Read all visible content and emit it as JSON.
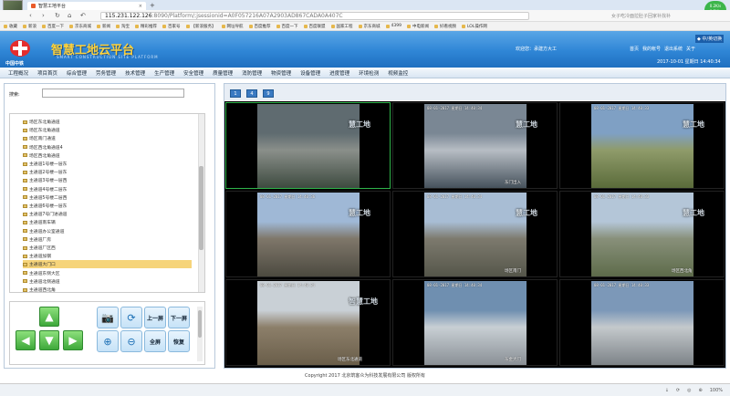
{
  "browser": {
    "tab_title": "智慧工地平台",
    "tab_close": "×",
    "new_tab": "+",
    "url_host": "115.231.122.126",
    "url_path": ":8090/Platform/;jsessionid=A0F057216A07A2903AD867CADA0A407C",
    "search_hint": "女子吃冷面拉肚子回家补找补",
    "speed_value": "0.2K/s",
    "speed_label": "0.5K/s",
    "bookmarks": [
      "收藏",
      "新浪",
      "百度一下",
      "京东商城",
      "新闻",
      "淘宝",
      "精彩推荐",
      "百家号",
      "【新浪服务】",
      "网址导航",
      "百度推荐",
      "百度一下",
      "百度联盟",
      "国家工程",
      "京东商城",
      "4399",
      "中电新闻",
      "好看视频",
      "LOL操作网"
    ]
  },
  "header": {
    "logo_text": "智慧工地云平台",
    "logo_sub": "SMART CONSTRUCTION SITE PLATFORM",
    "logo_cn": "中国中铁",
    "user_info": "欢迎您：承建方大工",
    "quick_links": [
      "首页",
      "我的帐号",
      "退出系统",
      "关于"
    ],
    "switch": "◆ 中/英切换",
    "datetime": "2017-10-01  星期日  14:40:34"
  },
  "menu": [
    "工程概况",
    "项目首页",
    "综合管理",
    "劳务管理",
    "技术管理",
    "生产管理",
    "安全管理",
    "质量管理",
    "消防管理",
    "物资管理",
    "设备管理",
    "进度管理",
    "环境检测",
    "视频监控"
  ],
  "left": {
    "search_label": "搜索:",
    "search_value": "",
    "tree": [
      "场区东北角通道",
      "场区东北角通道",
      "场区南门通道",
      "场区西北角通道4",
      "场区西北角通道",
      "主通道1号楼一层东",
      "主通道2号楼一层东",
      "主通道3号楼一层西",
      "主通道4号楼二层东",
      "主通道5号楼二层西",
      "主通道6号楼一层东",
      "主通道7号门进通道",
      "主通道南车辆",
      "主通道办公室通道",
      "主通道厂房",
      "主通道厂区西",
      "主通道加钢",
      "主通道大门口",
      "主通道东侧大区",
      "主通道北侧通道",
      "主通道西北角"
    ],
    "selected_index": 17,
    "controls": {
      "up": "▲",
      "down": "▼",
      "left": "◀",
      "right": "▶",
      "snapshot": "📷",
      "rotate": "⟳",
      "zoom_in": "⊕",
      "zoom_out": "⊖",
      "prev_page": "上一屏",
      "next_page": "下一屏",
      "fullscreen": "全屏",
      "restore": "恢复"
    }
  },
  "layout_buttons": [
    "1",
    "4",
    "9"
  ],
  "cameras": [
    {
      "timestamp": "",
      "watermark": "慧工地",
      "name": ""
    },
    {
      "timestamp": "08-01-2017  星期日  14:40:34",
      "watermark": "慧工地",
      "name": "东门出入"
    },
    {
      "timestamp": "08-01-2017  星期日  14:40:33",
      "watermark": "慧工地",
      "name": ""
    },
    {
      "timestamp": "08-01-2017  星期日  14:40:36",
      "watermark": "慧工地",
      "name": ""
    },
    {
      "timestamp": "08-01-2017  星期日  14:40:34",
      "watermark": "慧工地",
      "name": "场区南门"
    },
    {
      "timestamp": "08-01-2017  星期日  14:40:33",
      "watermark": "慧工地",
      "name": "场区西北角"
    },
    {
      "timestamp": "08-01-2017  星期日  14:40:34",
      "watermark": "智慧工地",
      "name": "场区东北通道"
    },
    {
      "timestamp": "08-01-2017  星期日  14:40:34",
      "watermark": "",
      "name": "东金大门"
    },
    {
      "timestamp": "08-01-2017  星期日  14:40:33",
      "watermark": "",
      "name": ""
    }
  ],
  "footer": "Copyright 2017  北京筑客众为科技发展有限公司 版权所有",
  "status": [
    "↓",
    "⟳",
    "◎",
    "⊕",
    "100%"
  ]
}
